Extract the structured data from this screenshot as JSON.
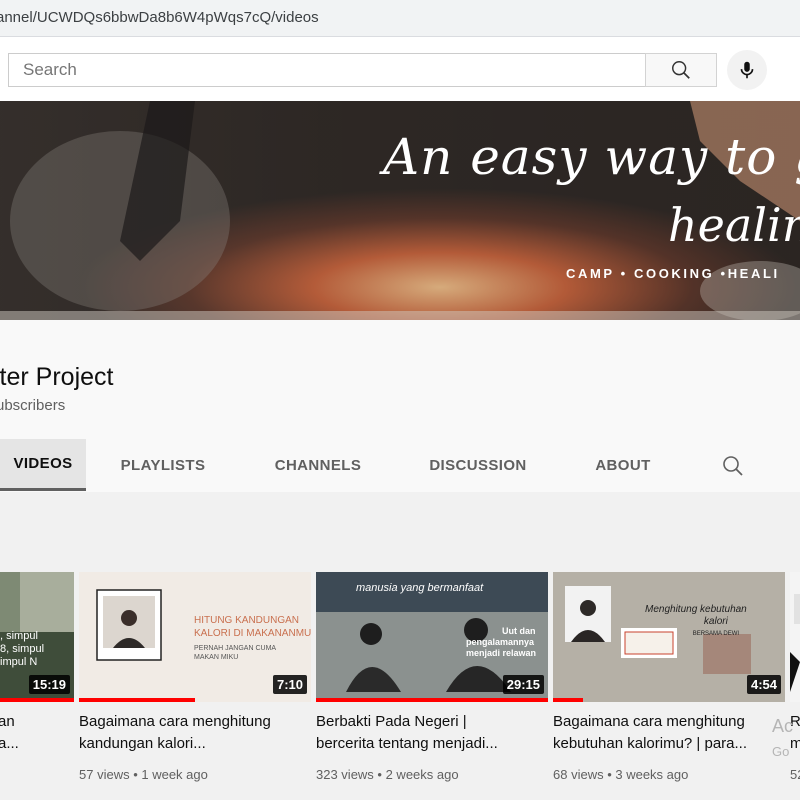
{
  "browser": {
    "url": "annel/UCWDQs6bbwDa8b6W4pWqs7cQ/videos"
  },
  "header": {
    "search_placeholder": "Search",
    "icons": {
      "search": "search-icon",
      "mic": "mic-icon"
    }
  },
  "banner": {
    "line1": "An easy way to ge",
    "line2": "healing",
    "tagline": "CAMP • COOKING •HEALI"
  },
  "channel": {
    "name": "lter Project",
    "subscribers": "ubscribers"
  },
  "tabs": [
    {
      "label": "VIDEOS",
      "active": true
    },
    {
      "label": "PLAYLISTS"
    },
    {
      "label": "CHANNELS"
    },
    {
      "label": "DISCUSSION"
    },
    {
      "label": "ABOUT"
    }
  ],
  "videos": [
    {
      "title_line1": "an",
      "title_line2": "a...",
      "duration": "15:19",
      "thumb_text": ", simpul\n8, simpul\nimpul N",
      "progress": 1.0
    },
    {
      "title_line1": "Bagaimana cara menghitung",
      "title_line2": "kandungan kalori...",
      "duration": "7:10",
      "views": "57 views",
      "age": "1 week ago",
      "thumb_text1": "HITUNG KANDUNGAN",
      "thumb_text2": "KALORI DI MAKANANMU",
      "thumb_text3": "PERNAH JANGAN CUMA",
      "thumb_text4": "MAKAN MIKU",
      "progress": 0.5
    },
    {
      "title_line1": "Berbakti Pada Negeri |",
      "title_line2": "bercerita tentang menjadi...",
      "duration": "29:15",
      "views": "323 views",
      "age": "2 weeks ago",
      "thumb_text1": "manusia yang bermanfaat",
      "thumb_text2": "Uut dan",
      "thumb_text3": "pengalamannya",
      "thumb_text4": "menjadi relawan",
      "progress": 1.0
    },
    {
      "title_line1": "Bagaimana cara menghitung",
      "title_line2": "kebutuhan kalorimu? | para...",
      "duration": "4:54",
      "views": "68 views",
      "age": "3 weeks ago",
      "thumb_text1": "Menghitung kebutuhan",
      "thumb_text2": "kalori",
      "thumb_text3": "BERSAMA DEWI",
      "progress": 0.13
    },
    {
      "title_line1": "R",
      "title_line2": "m",
      "meta": "52"
    }
  ],
  "watermark": {
    "line1": "Ac",
    "line2": "Go"
  },
  "colors": {
    "accent": "#ff0000",
    "tab_active_bg": "#e5e5e5"
  }
}
